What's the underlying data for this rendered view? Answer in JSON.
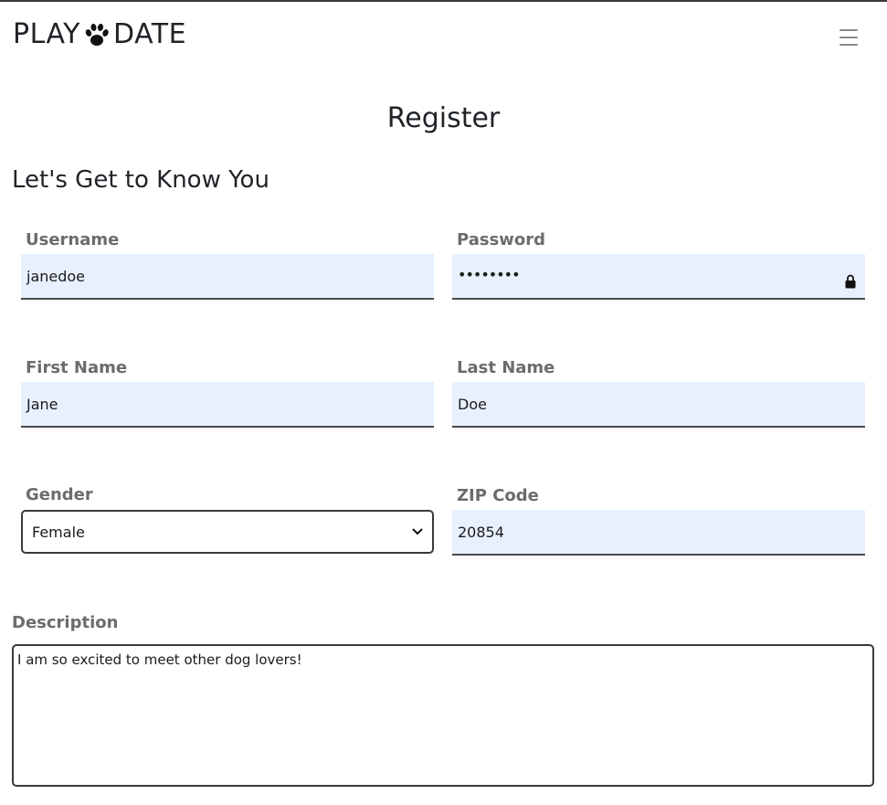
{
  "brand": {
    "left": "PLAY",
    "right": "DATE",
    "icon": "paw-icon"
  },
  "nav": {
    "menu_icon": "hamburger-menu-icon"
  },
  "page": {
    "title": "Register",
    "section_title": "Let's Get to Know You"
  },
  "form": {
    "username": {
      "label": "Username",
      "value": "janedoe"
    },
    "password": {
      "label": "Password",
      "value": "••••••••",
      "icon": "lock-icon"
    },
    "first_name": {
      "label": "First Name",
      "value": "Jane"
    },
    "last_name": {
      "label": "Last Name",
      "value": "Doe"
    },
    "gender": {
      "label": "Gender",
      "value": "Female",
      "icon": "chevron-down-icon"
    },
    "zip": {
      "label": "ZIP Code",
      "value": "20854"
    },
    "description": {
      "label": "Description",
      "value": "I am so excited to meet other dog lovers!"
    }
  },
  "colors": {
    "field_bg": "#e8f0fe",
    "label": "#6e6a6e",
    "text": "#1f2328"
  }
}
